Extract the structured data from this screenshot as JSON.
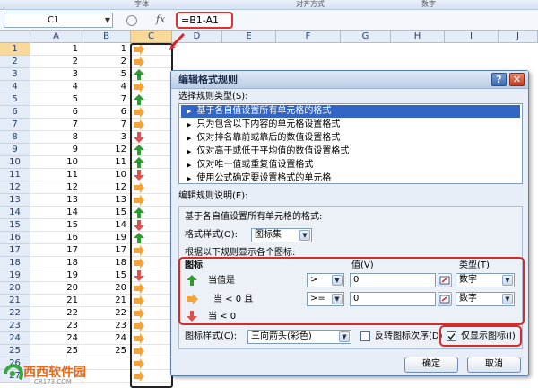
{
  "ribbon": {
    "tabs": [
      "字体",
      "对齐方式",
      "数字"
    ]
  },
  "formula_bar": {
    "name_box": "C1",
    "fx": "fx",
    "formula": "=B1-A1"
  },
  "columns": [
    "A",
    "B",
    "C",
    "D",
    "E",
    "F",
    "G",
    "H",
    "I",
    "J"
  ],
  "rows": [
    {
      "n": "1",
      "a": "1",
      "b": "1",
      "icon": "right"
    },
    {
      "n": "2",
      "a": "2",
      "b": "2",
      "icon": "right"
    },
    {
      "n": "3",
      "a": "3",
      "b": "5",
      "icon": "up"
    },
    {
      "n": "4",
      "a": "4",
      "b": "4",
      "icon": "right"
    },
    {
      "n": "5",
      "a": "5",
      "b": "7",
      "icon": "up"
    },
    {
      "n": "6",
      "a": "6",
      "b": "6",
      "icon": "right"
    },
    {
      "n": "7",
      "a": "7",
      "b": "7",
      "icon": "right"
    },
    {
      "n": "8",
      "a": "8",
      "b": "3",
      "icon": "down"
    },
    {
      "n": "9",
      "a": "9",
      "b": "12",
      "icon": "up"
    },
    {
      "n": "10",
      "a": "10",
      "b": "11",
      "icon": "up"
    },
    {
      "n": "11",
      "a": "11",
      "b": "10",
      "icon": "down"
    },
    {
      "n": "12",
      "a": "12",
      "b": "12",
      "icon": "right"
    },
    {
      "n": "13",
      "a": "13",
      "b": "13",
      "icon": "right"
    },
    {
      "n": "14",
      "a": "14",
      "b": "15",
      "icon": "up"
    },
    {
      "n": "15",
      "a": "15",
      "b": "14",
      "icon": "down"
    },
    {
      "n": "16",
      "a": "16",
      "b": "19",
      "icon": "up"
    },
    {
      "n": "17",
      "a": "17",
      "b": "17",
      "icon": "right"
    },
    {
      "n": "18",
      "a": "18",
      "b": "18",
      "icon": "right"
    },
    {
      "n": "19",
      "a": "19",
      "b": "15",
      "icon": "down"
    },
    {
      "n": "20",
      "a": "20",
      "b": "20",
      "icon": "right"
    },
    {
      "n": "21",
      "a": "21",
      "b": "21",
      "icon": "right"
    },
    {
      "n": "22",
      "a": "22",
      "b": "22",
      "icon": "right"
    },
    {
      "n": "23",
      "a": "23",
      "b": "23",
      "icon": "right"
    },
    {
      "n": "24",
      "a": "24",
      "b": "24",
      "icon": "right"
    },
    {
      "n": "25",
      "a": "25",
      "b": "25",
      "icon": "right"
    },
    {
      "n": "26",
      "a": "",
      "b": "",
      "icon": "right"
    },
    {
      "n": "27",
      "a": "",
      "b": "",
      "icon": "right"
    }
  ],
  "dialog": {
    "title": "编辑格式规则",
    "help": "?",
    "close": "✕",
    "rule_type_label": "选择规则类型(S):",
    "rule_types": [
      "基于各自值设置所有单元格的格式",
      "只为包含以下内容的单元格设置格式",
      "仅对排名靠前或靠后的数值设置格式",
      "仅对高于或低于平均值的数值设置格式",
      "仅对唯一值或重复值设置格式",
      "使用公式确定要设置格式的单元格"
    ],
    "edit_label": "编辑规则说明(E):",
    "based_label": "基于各自值设置所有单元格的格式:",
    "format_style_label": "格式样式(O):",
    "format_style_value": "图标集",
    "show_rule_label": "根据以下规则显示各个图标:",
    "icon_header": "图标",
    "value_header": "值(V)",
    "type_header": "类型(T)",
    "rules": [
      {
        "text": "当值是",
        "op": ">",
        "value": "0",
        "type": "数字"
      },
      {
        "text": "当 < 0 且",
        "op": ">=",
        "value": "0",
        "type": "数字"
      },
      {
        "text": "当 < 0",
        "op": "",
        "value": "",
        "type": ""
      }
    ],
    "icon_style_label": "图标样式(C):",
    "icon_style_value": "三向箭头(彩色)",
    "reverse_label": "反转图标次序(D)",
    "show_icon_only_label": "仅显示图标(I)",
    "show_icon_only_checked": true,
    "ok": "确定",
    "cancel": "取消"
  },
  "watermark": {
    "brand": "西西软件园",
    "site": "CR173.COM"
  },
  "colors": {
    "up": "#2f9a2f",
    "right": "#f2a33a",
    "down": "#e05050",
    "highlight": "#d42a2a",
    "select": "#3166c6"
  }
}
